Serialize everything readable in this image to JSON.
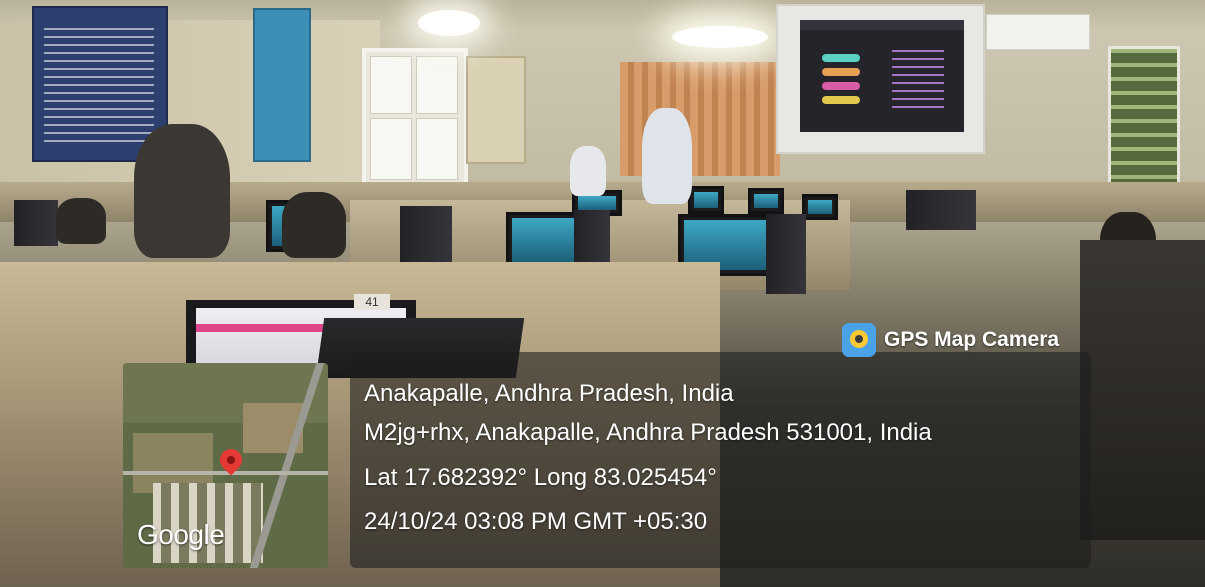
{
  "overlay": {
    "app_name": "GPS Map Camera",
    "location_title": "Anakapalle, Andhra Pradesh, India",
    "address": "M2jg+rhx, Anakapalle, Andhra Pradesh 531001, India",
    "coordinates": "Lat 17.682392° Long 83.025454°",
    "datetime": "24/10/24 03:08 PM GMT +05:30",
    "map_provider": "Google"
  },
  "scene": {
    "desk_number": "41"
  },
  "colors": {
    "accent_pink": "#e0478a",
    "app_icon_blue": "#4aa3e8",
    "map_pin_red": "#e53935"
  },
  "icons": [
    "gps-map-camera-app-icon",
    "map-pin-icon"
  ]
}
